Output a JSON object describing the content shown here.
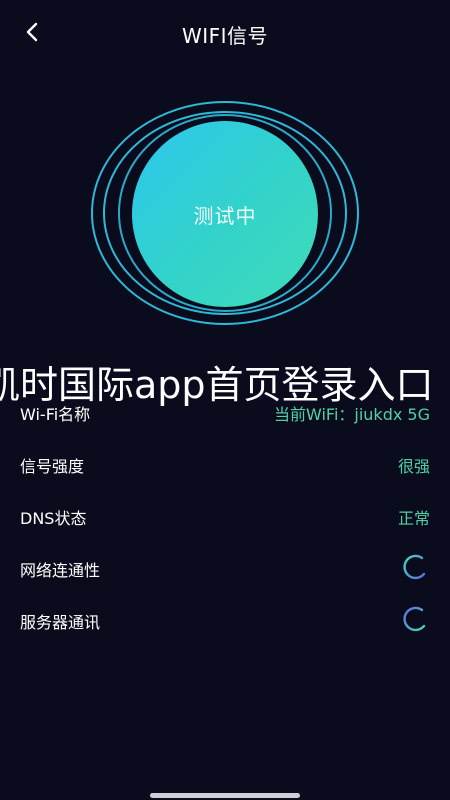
{
  "header": {
    "title": "WIFI信号",
    "back_icon": "chevron-left-icon"
  },
  "gauge": {
    "status": "测试中",
    "colors": {
      "start": "#2cc7ee",
      "end": "#3fdcb7",
      "ring": "#38c8e0"
    }
  },
  "banner": {
    "text": "凯时国际app首页登录入口"
  },
  "rows": [
    {
      "label": "Wi-Fi名称",
      "value": "当前WiFi：jiukdx 5G"
    },
    {
      "label": "信号强度",
      "value": "很强"
    },
    {
      "label": "DNS状态",
      "value": "正常"
    },
    {
      "label": "网络连通性",
      "status_icon": "loading-spinner-icon"
    },
    {
      "label": "服务器通讯",
      "status_icon": "loading-spinner-icon"
    }
  ],
  "accent_color": "#4fd1a6"
}
